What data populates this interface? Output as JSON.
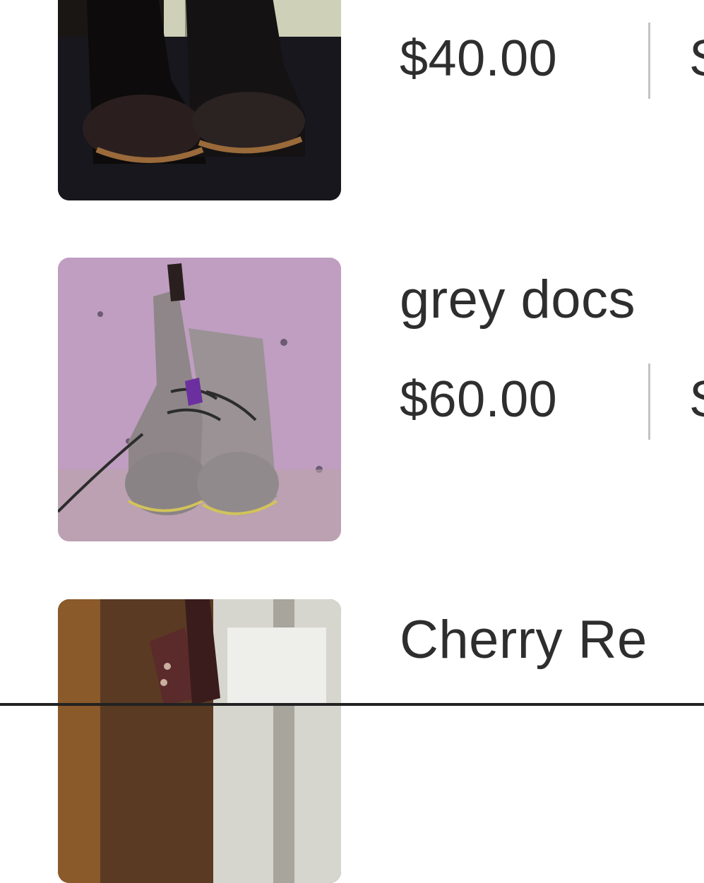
{
  "listings": [
    {
      "title": "",
      "price": "$40.00",
      "next_char": "S",
      "image": "black-boots-photo"
    },
    {
      "title": "grey docs",
      "price": "$60.00",
      "next_char": "S",
      "image": "grey-boots-on-carpet-photo"
    },
    {
      "title": "Cherry Re",
      "price": "",
      "next_char": "",
      "image": "cherry-red-boots-photo"
    }
  ],
  "colors": {
    "text": "#2e2e2e",
    "separator": "#c4c4c4",
    "background": "#ffffff"
  }
}
